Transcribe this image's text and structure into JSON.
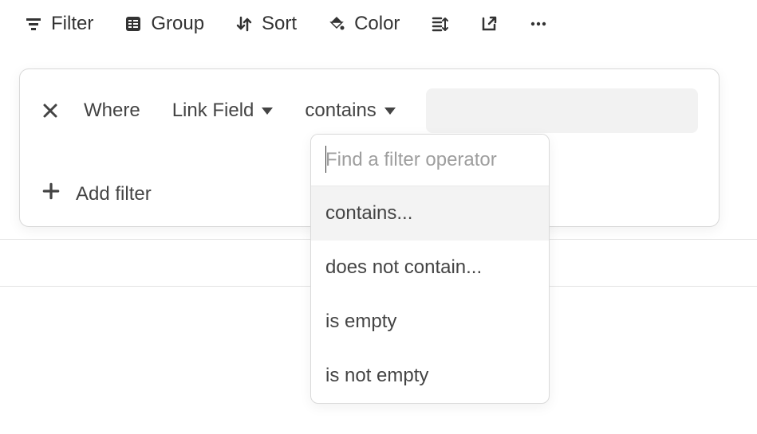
{
  "toolbar": {
    "filter_label": "Filter",
    "group_label": "Group",
    "sort_label": "Sort",
    "color_label": "Color"
  },
  "filterPanel": {
    "where_label": "Where",
    "field_label": "Link Field",
    "operator_label": "contains",
    "value": "",
    "addFilter_label": "Add filter"
  },
  "operatorPopup": {
    "search_placeholder": "Find a filter operator",
    "search_value": "",
    "options": [
      {
        "label": "contains...",
        "highlighted": true
      },
      {
        "label": "does not contain...",
        "highlighted": false
      },
      {
        "label": "is empty",
        "highlighted": false
      },
      {
        "label": "is not empty",
        "highlighted": false
      }
    ]
  }
}
